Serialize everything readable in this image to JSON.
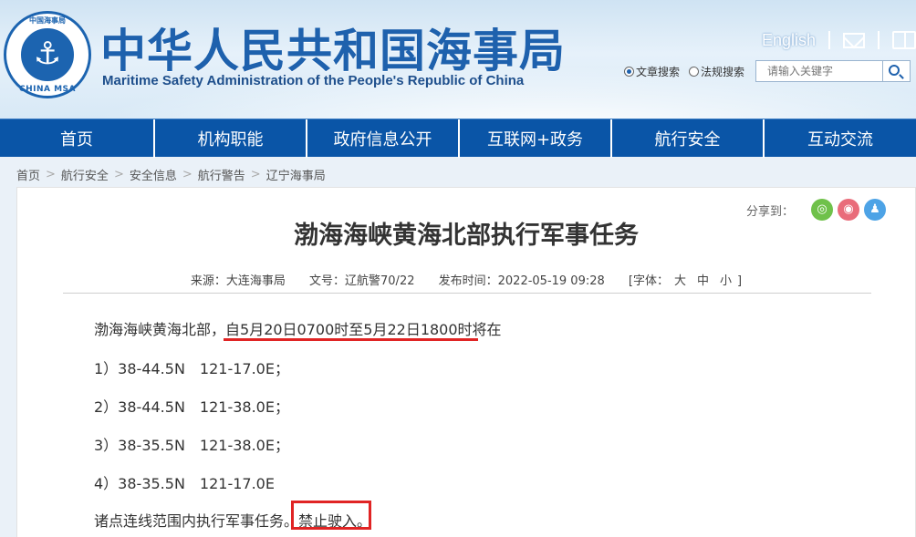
{
  "header": {
    "title_cn": "中华人民共和国海事局",
    "title_en": "Maritime Safety Administration of the People's Republic of China",
    "logo_top": "中国海事局",
    "logo_bottom": "CHINA MSA",
    "english_link": "English",
    "search": {
      "option_article": "文章搜索",
      "option_law": "法规搜索",
      "placeholder": "请输入关键字"
    }
  },
  "nav": {
    "items": [
      "首页",
      "机构职能",
      "政府信息公开",
      "互联网+政务",
      "航行安全",
      "互动交流"
    ]
  },
  "breadcrumb": [
    "首页",
    "航行安全",
    "安全信息",
    "航行警告",
    "辽宁海事局"
  ],
  "article": {
    "share_label": "分享到：",
    "title": "渤海海峡黄海北部执行军事任务",
    "meta": {
      "source": "来源：大连海事局",
      "doc_no": "文号：辽航警70/22",
      "published": "发布时间：2022-05-19 09:28",
      "font_open": "[字体：",
      "font_large": "大",
      "font_medium": "中",
      "font_small": "小",
      "font_close": "]"
    },
    "lead_plain": "渤海海峡黄海北部，",
    "lead_marked": "自5月20日0700时至5月22日1800时将在",
    "points": [
      "1）38-44.5N　121-17.0E；",
      "2）38-44.5N　121-38.0E；",
      "3）38-35.5N　121-38.0E；",
      "4）38-35.5N　121-17.0E"
    ],
    "closing_plain": "诸点连线范围内执行军事任务。",
    "closing_marked": "禁止驶入。"
  },
  "colors": {
    "nav_bg": "#0a55a7",
    "brand_blue": "#1e61ad",
    "highlight_red": "#e02424"
  }
}
